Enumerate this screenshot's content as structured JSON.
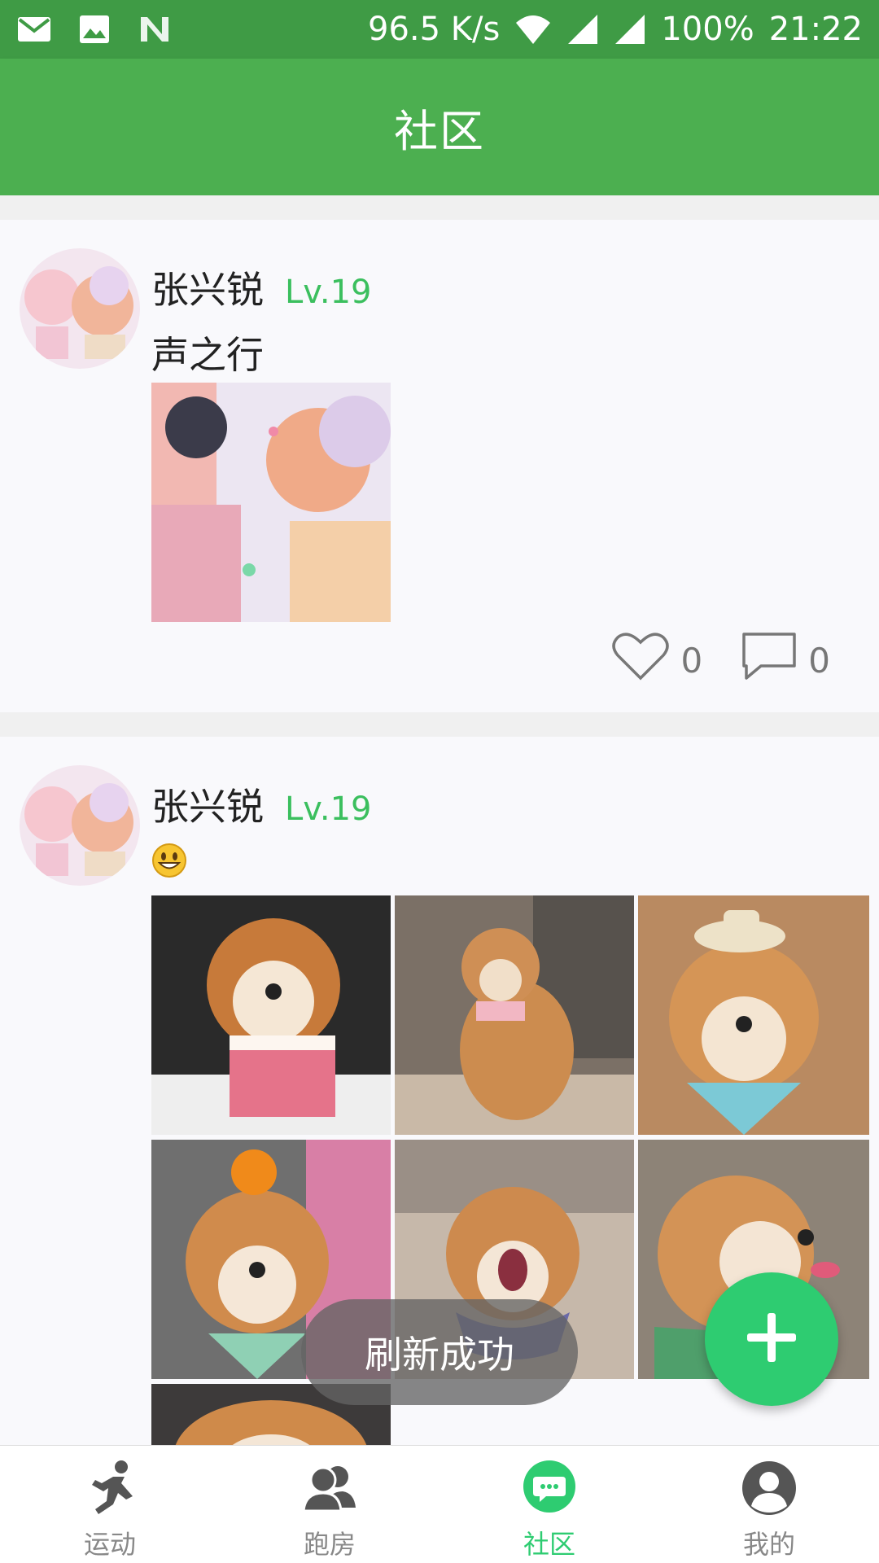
{
  "status_bar": {
    "speed": "96.5 K/s",
    "battery": "100%",
    "time": "21:22",
    "icons": [
      "mail-icon",
      "image-icon",
      "n-icon",
      "wifi-icon",
      "signal-icon"
    ]
  },
  "app_bar": {
    "title": "社区"
  },
  "posts": [
    {
      "user": "张兴锐",
      "level": "Lv.19",
      "text": "声之行",
      "likes": "0",
      "comments": "0",
      "images": 1
    },
    {
      "user": "张兴锐",
      "level": "Lv.19",
      "emoji": "grinning-face-emoji",
      "images": 7
    }
  ],
  "toast": "刷新成功",
  "fab": {
    "icon": "plus-icon"
  },
  "bottom_nav": {
    "items": [
      {
        "label": "运动",
        "icon": "running-icon"
      },
      {
        "label": "跑房",
        "icon": "group-icon"
      },
      {
        "label": "社区",
        "icon": "chat-icon",
        "active": true
      },
      {
        "label": "我的",
        "icon": "profile-icon"
      }
    ]
  },
  "colors": {
    "status_bar": "#3f9b45",
    "app_bar": "#4caf50",
    "accent": "#2ecc71",
    "level": "#3bbf5e"
  }
}
